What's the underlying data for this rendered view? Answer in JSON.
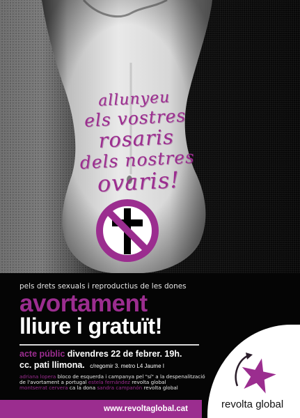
{
  "slogan": {
    "line1": "allunyeu",
    "line2": "els vostres",
    "line3": "rosaris",
    "line4": "dels nostres",
    "line5": "ovaris!"
  },
  "tagline": "pels drets sexuals i reproductius de les dones",
  "headline": {
    "line1": "avortament",
    "line2": "lliure i gratuït!"
  },
  "event": {
    "label": "acte públic",
    "datetime": "divendres 22 de febrer. 19h.",
    "venue": "cc. pati llimona.",
    "address": "c/regomir 3. metro L4 Jaume I"
  },
  "speakers": [
    {
      "name": "adriana lopera",
      "role": "bloco de esquerda i campanya pel \"sí\" a la despenalització"
    },
    {
      "name": "",
      "role": "de l'avortament a portugal"
    },
    {
      "name": "estela fernández",
      "role": "revolta global"
    },
    {
      "name": "montserrat cervera",
      "role": "ca la dona"
    },
    {
      "name": "sandra campanón",
      "role": "revolta global"
    }
  ],
  "website": "www.revoltaglobal.cat",
  "logo_text": "revolta global",
  "colors": {
    "accent": "#9b2d8f",
    "background": "#050505",
    "text": "#ffffff"
  },
  "icons": [
    "no-cross-sign-icon",
    "revolta-global-star-logo-icon"
  ]
}
